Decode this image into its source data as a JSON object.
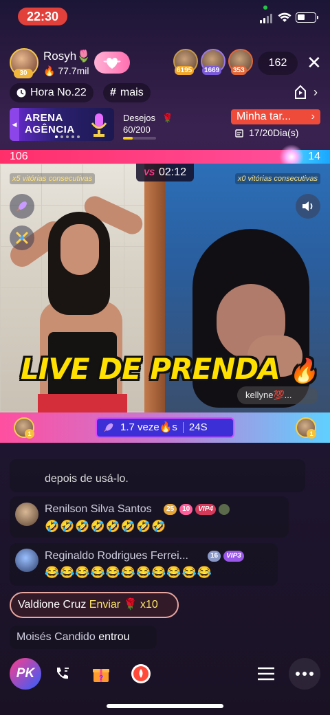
{
  "status_bar": {
    "time": "22:30"
  },
  "host": {
    "name": "Rosyh",
    "name_emoji": "🌷",
    "level": "30",
    "stat": "77.7mil",
    "stat_icon": "flame-icon"
  },
  "top_viewers": [
    {
      "badge": "6195",
      "badge_color": "#f0a72b"
    },
    {
      "badge": "1669",
      "badge_color": "#7a5ad8"
    },
    {
      "badge": "353",
      "badge_color": "#e1683a"
    }
  ],
  "viewer_count": "162",
  "chips": {
    "hour_rank": "Hora No.22",
    "hashtag": "mais"
  },
  "arena": {
    "title_line1": "ARENA",
    "title_line2": "AGÊNCIA"
  },
  "wish": {
    "label": "Desejos",
    "value": "60/200",
    "progress": 0.3
  },
  "task": {
    "button": "Minha tar...",
    "progress": "17/20Dia(s)"
  },
  "pk": {
    "score_left": "106",
    "score_right": "14",
    "timer": "02:12",
    "vs_label": "VS",
    "left_streak": "x5 vitórias consecutivas",
    "right_streak": "x0 vitórias consecutivas",
    "left_share": 0.883,
    "opponent_tag": "kellyne💯...",
    "overlay_text": "LIVE DE PRENDA",
    "boost_text": "1.7 veze",
    "boost_text_tail": "s",
    "boost_time": "24S",
    "left_rank": "1",
    "right_rank": "1"
  },
  "chat": [
    {
      "type": "system",
      "text": "depois de usá-lo."
    },
    {
      "type": "message",
      "name": "Renilson Silva Santos",
      "badges": [
        "25",
        "10",
        "VIP4"
      ],
      "emojis": "🤣🤣🤣🤣🤣🤣🤣🤣"
    },
    {
      "type": "message",
      "name": "Reginaldo Rodrigues Ferrei...",
      "badges": [
        "16",
        "VIP3"
      ],
      "emojis": "😂😂😂😂😂😂😂😂😂😂😂"
    },
    {
      "type": "gift",
      "name": "Valdione Cruz",
      "action": "Enviar",
      "gift_emoji": "🌹",
      "count": "x10"
    },
    {
      "type": "join",
      "name": "Moisés Candido",
      "action": "entrou"
    }
  ],
  "toolbar": {
    "pk_label": "PK"
  }
}
